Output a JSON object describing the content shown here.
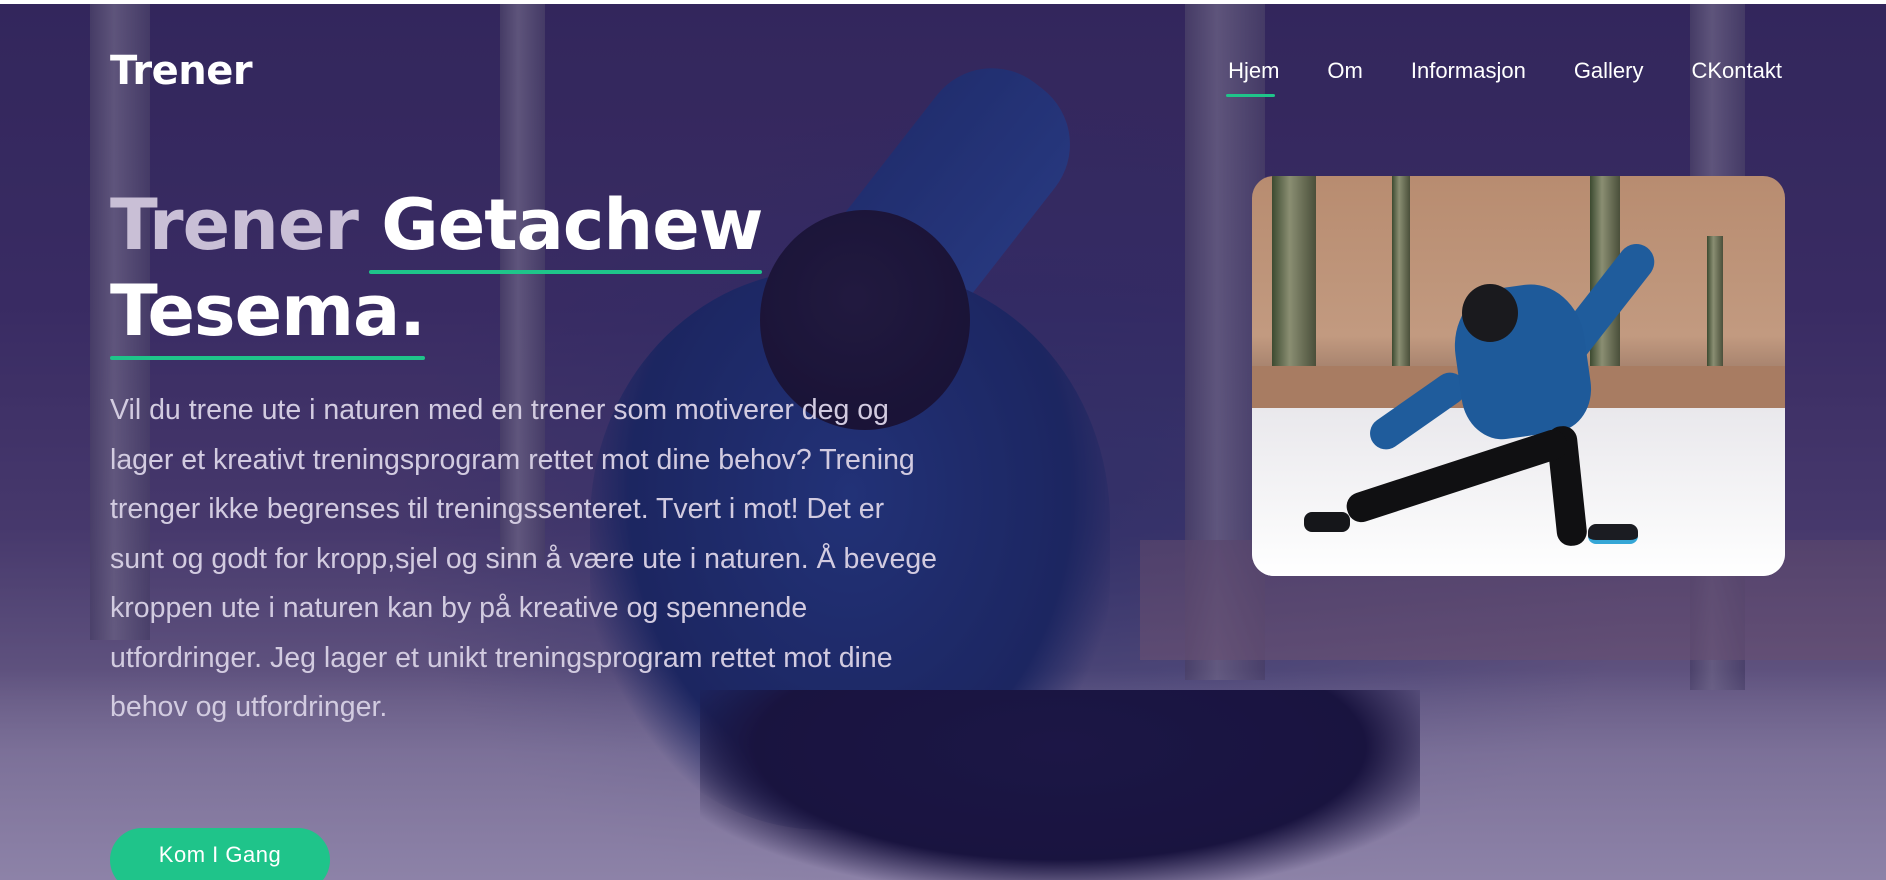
{
  "brand": {
    "logo": "Trener"
  },
  "nav": {
    "items": [
      {
        "label": "Hjem",
        "active": true
      },
      {
        "label": "Om"
      },
      {
        "label": "Informasjon"
      },
      {
        "label": "Gallery"
      },
      {
        "label": "CKontakt"
      }
    ]
  },
  "hero": {
    "title_part1": "Trener",
    "title_part2": "Getachew",
    "title_part3": "Tesema.",
    "paragraph": "Vil du trene ute i naturen med en trener som motiverer deg og lager et kreativt treningsprogram rettet mot dine behov? Trening trenger ikke begrenses til treningssenteret. Tvert i mot! Det er sunt og godt for kropp,sjel og sinn å være ute i naturen. Å bevege kroppen ute i naturen kan by på kreative og spennende utfordringer. Jeg lager et unikt treningsprogram rettet mot dine behov og utfordringer.",
    "cta_label": "Kom I Gang"
  },
  "colors": {
    "accent": "#1fc48a",
    "overlay": "#3a2d5e",
    "text": "#ffffff",
    "muted_text": "#d2cbe0"
  }
}
